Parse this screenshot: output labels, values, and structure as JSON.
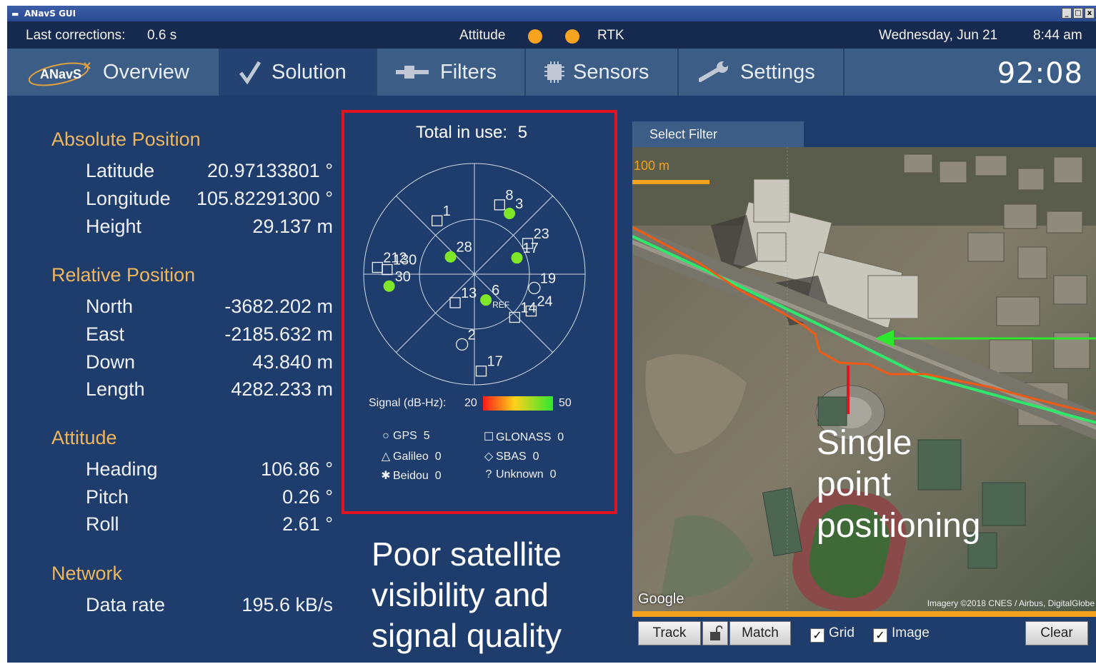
{
  "window": {
    "title": "ANavS GUI"
  },
  "status": {
    "last_corrections_label": "Last corrections:",
    "last_corrections_value": "0.6 s",
    "attitude_label": "Attitude",
    "rtk_label": "RTK",
    "indicator_color": "#f6a31f",
    "date": "Wednesday, Jun 21",
    "time": "8:44 am"
  },
  "nav": {
    "logo_text": "ANavS",
    "tabs": [
      {
        "label": "Overview",
        "icon": "anavs-logo"
      },
      {
        "label": "Solution",
        "icon": "checkmark-icon"
      },
      {
        "label": "Filters",
        "icon": "filter-icon"
      },
      {
        "label": "Sensors",
        "icon": "chip-icon"
      },
      {
        "label": "Settings",
        "icon": "wrench-icon"
      }
    ],
    "active_tab": "Solution",
    "clock": "92:08"
  },
  "absolute_position": {
    "title": "Absolute Position",
    "rows": [
      {
        "label": "Latitude",
        "value": "20.97133801 °"
      },
      {
        "label": "Longitude",
        "value": "105.82291300 °"
      },
      {
        "label": "Height",
        "value": "29.137 m"
      }
    ]
  },
  "relative_position": {
    "title": "Relative Position",
    "rows": [
      {
        "label": "North",
        "value": "-3682.202 m"
      },
      {
        "label": "East",
        "value": "-2185.632 m"
      },
      {
        "label": "Down",
        "value": "43.840 m"
      },
      {
        "label": "Length",
        "value": "4282.233 m"
      }
    ]
  },
  "attitude": {
    "title": "Attitude",
    "rows": [
      {
        "label": "Heading",
        "value": "106.86 °"
      },
      {
        "label": "Pitch",
        "value": "0.26 °"
      },
      {
        "label": "Roll",
        "value": "2.61 °"
      }
    ]
  },
  "network": {
    "title": "Network",
    "rows": [
      {
        "label": "Data rate",
        "value": "195.6  kB/s"
      }
    ]
  },
  "skyplot": {
    "total_label": "Total in use:",
    "total_value": "5",
    "ref_label": "REF",
    "signal_label": "Signal (dB-Hz):",
    "signal_min": "20",
    "signal_max": "50",
    "satellites": [
      {
        "id": "8",
        "system": "GLONASS",
        "azimuth_deg": 20,
        "elevation_deg": 30,
        "in_use": false
      },
      {
        "id": "3",
        "system": "GPS",
        "azimuth_deg": 30,
        "elevation_deg": 33,
        "in_use": true
      },
      {
        "id": "1",
        "system": "GLONASS",
        "azimuth_deg": 325,
        "elevation_deg": 37,
        "in_use": false
      },
      {
        "id": "28",
        "system": "GPS",
        "azimuth_deg": 306,
        "elevation_deg": 66,
        "in_use": true
      },
      {
        "id": "23",
        "system": "GLONASS",
        "azimuth_deg": 60,
        "elevation_deg": 40,
        "in_use": false
      },
      {
        "id": "17",
        "system": "GPS",
        "azimuth_deg": 69,
        "elevation_deg": 53,
        "in_use": true
      },
      {
        "id": "212",
        "system": "GLONASS",
        "azimuth_deg": 274,
        "elevation_deg": 11,
        "in_use": false
      },
      {
        "id": "130",
        "system": "GLONASS",
        "azimuth_deg": 273,
        "elevation_deg": 19,
        "in_use": false
      },
      {
        "id": "30",
        "system": "GPS",
        "azimuth_deg": 262,
        "elevation_deg": 20,
        "in_use": true
      },
      {
        "id": "19",
        "system": "GPS",
        "azimuth_deg": 103,
        "elevation_deg": 40,
        "in_use": false
      },
      {
        "id": "13",
        "system": "GLONASS",
        "azimuth_deg": 214,
        "elevation_deg": 62,
        "in_use": false
      },
      {
        "id": "6",
        "system": "GPS",
        "azimuth_deg": 156,
        "elevation_deg": 67,
        "in_use": true
      },
      {
        "id": "24",
        "system": "GLONASS",
        "azimuth_deg": 123,
        "elevation_deg": 35,
        "in_use": false
      },
      {
        "id": "14",
        "system": "GLONASS",
        "azimuth_deg": 137,
        "elevation_deg": 42,
        "in_use": false
      },
      {
        "id": "2",
        "system": "GPS",
        "azimuth_deg": 190,
        "elevation_deg": 32,
        "in_use": false
      },
      {
        "id": "17",
        "system": "GLONASS",
        "azimuth_deg": 176,
        "elevation_deg": 11,
        "in_use": false
      }
    ],
    "legend": [
      {
        "symbol": "○",
        "name": "GPS",
        "count": "5"
      },
      {
        "symbol": "☐",
        "name": "GLONASS",
        "count": "0"
      },
      {
        "symbol": "△",
        "name": "Galileo",
        "count": "0"
      },
      {
        "symbol": "◇",
        "name": "SBAS",
        "count": "0"
      },
      {
        "symbol": "✱",
        "name": "Beidou",
        "count": "0"
      },
      {
        "symbol": "?",
        "name": "Unknown",
        "count": "0"
      }
    ],
    "colors": {
      "in_use": "#7ee828",
      "grid": "#d0dbe8"
    }
  },
  "annotations": {
    "poor_visibility": [
      "Poor satellite",
      "visibility and",
      "signal quality"
    ],
    "single_point": [
      "Single",
      "point",
      "positioning"
    ]
  },
  "map": {
    "filter_tab": "Select Filter",
    "scale_label": "100 m",
    "google_label": "Google",
    "imagery_credit": "Imagery ©2018 CNES / Airbus, DigitalGlobe",
    "track_color_rtk": "#2ee86a",
    "track_color_spp": "#f05a14",
    "controls": {
      "track": "Track",
      "match": "Match",
      "grid": "Grid",
      "grid_checked": true,
      "image": "Image",
      "image_checked": true,
      "clear": "Clear"
    }
  }
}
